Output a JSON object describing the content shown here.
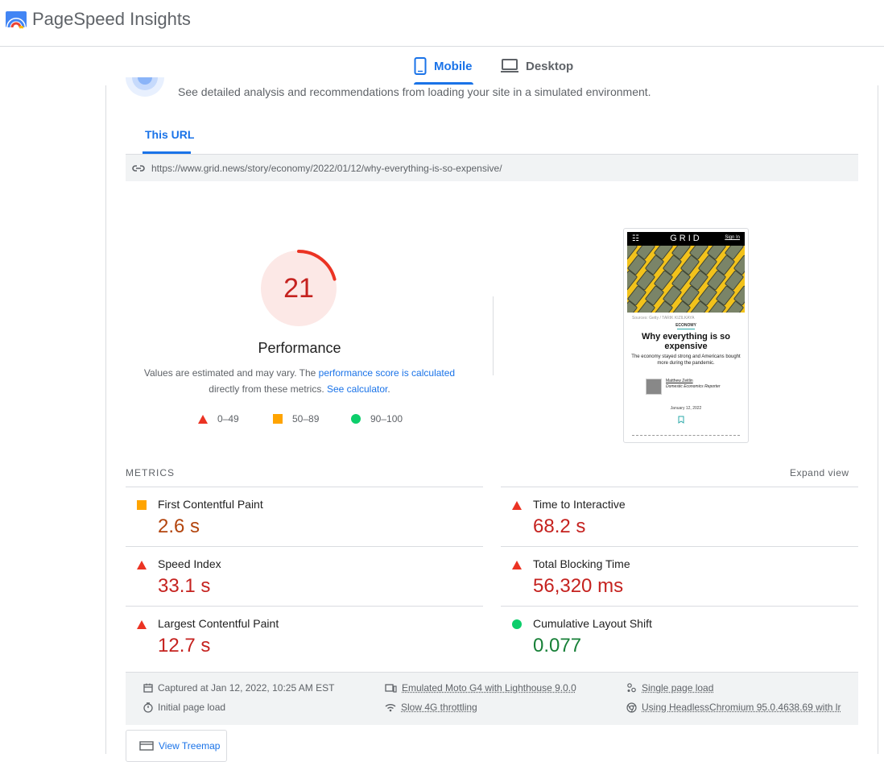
{
  "app": {
    "title": "PageSpeed Insights"
  },
  "device_tabs": [
    {
      "label": "Mobile",
      "selected": true
    },
    {
      "label": "Desktop",
      "selected": false
    }
  ],
  "intro": {
    "text": "See detailed analysis and recommendations from loading your site in a simulated environment."
  },
  "url_tab": {
    "label": "This URL"
  },
  "url": {
    "value": "https://www.grid.news/story/economy/2022/01/12/why-everything-is-so-expensive/"
  },
  "performance": {
    "score": "21",
    "score_fraction": 0.21,
    "label": "Performance",
    "note_part1": "Values are estimated and may vary. The ",
    "note_link1": "performance score is calculated",
    "note_part2": " directly from these metrics. ",
    "note_link2": "See calculator",
    "note_part3": ".",
    "color": "#c5221f",
    "legend": [
      {
        "range": "0–49",
        "shape": "triangle",
        "color": "#eb3323"
      },
      {
        "range": "50–89",
        "shape": "square",
        "color": "#ffa400"
      },
      {
        "range": "90–100",
        "shape": "circle",
        "color": "#0cce6b"
      }
    ]
  },
  "screenshot": {
    "logo": "GRID",
    "sign_in": "Sign In",
    "credit": "Sources: Getty / TARIK KIZILKAYA",
    "category": "ECONOMY",
    "headline": "Why everything is so expensive",
    "dek": "The economy stayed strong and Americans bought more during the pandemic.",
    "author": "Matthew Zeitlin",
    "role": "Domestic Economics Reporter",
    "date": "January 12, 2022"
  },
  "metrics": {
    "section_label": "METRICS",
    "expand_label": "Expand view",
    "items": [
      {
        "title": "First Contentful Paint",
        "value": "2.6 s",
        "rating": "average"
      },
      {
        "title": "Time to Interactive",
        "value": "68.2 s",
        "rating": "fail"
      },
      {
        "title": "Speed Index",
        "value": "33.1 s",
        "rating": "fail"
      },
      {
        "title": "Total Blocking Time",
        "value": "56,320 ms",
        "rating": "fail"
      },
      {
        "title": "Largest Contentful Paint",
        "value": "12.7 s",
        "rating": "fail"
      },
      {
        "title": "Cumulative Layout Shift",
        "value": "0.077",
        "rating": "pass"
      }
    ]
  },
  "run_info": {
    "captured": "Captured at Jan 12, 2022, 10:25 AM EST",
    "initial_load": "Initial page load",
    "device": "Emulated Moto G4 with Lighthouse 9.0.0",
    "throttling": "Slow 4G throttling",
    "single_load": "Single page load",
    "browser": "Using HeadlessChromium 95.0.4638.69 with lr"
  },
  "treemap": {
    "label": "View Treemap"
  }
}
